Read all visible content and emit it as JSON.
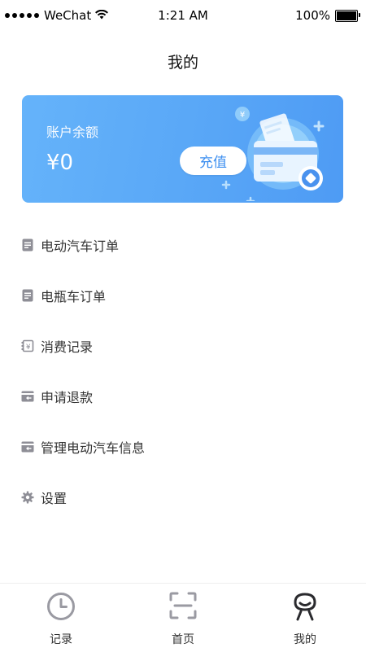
{
  "status_bar": {
    "carrier": "WeChat",
    "time": "1:21 AM",
    "battery_text": "100%"
  },
  "header": {
    "title": "我的"
  },
  "balance_card": {
    "label": "账户余额",
    "amount": "¥0",
    "recharge_label": "充值",
    "colors": {
      "gradient_start": "#65b3fa",
      "gradient_end": "#4e9bf4",
      "button_text": "#3d8ff0"
    }
  },
  "menu": {
    "items": [
      {
        "label": "电动汽车订单",
        "icon": "document-icon"
      },
      {
        "label": "电瓶车订单",
        "icon": "document-icon"
      },
      {
        "label": "消费记录",
        "icon": "receipt-yuan-icon"
      },
      {
        "label": "申请退款",
        "icon": "refund-card-icon"
      },
      {
        "label": "管理电动汽车信息",
        "icon": "manage-card-icon"
      },
      {
        "label": "设置",
        "icon": "gear-icon"
      }
    ]
  },
  "tab_bar": {
    "tabs": [
      {
        "label": "记录",
        "icon": "clock-icon"
      },
      {
        "label": "首页",
        "icon": "scan-icon"
      },
      {
        "label": "我的",
        "icon": "profile-icon",
        "active": true
      }
    ]
  }
}
